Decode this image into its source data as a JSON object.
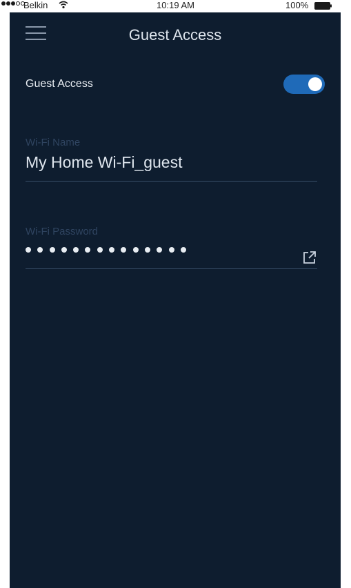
{
  "status_bar": {
    "signal": "●●●○○",
    "carrier": "Belkin",
    "time": "10:19 AM",
    "battery": "100%"
  },
  "header": {
    "menu_icon": "hamburger-icon",
    "title": "Guest Access"
  },
  "guest_access": {
    "label": "Guest Access",
    "enabled": true,
    "toggle_color": "#1f6ab8"
  },
  "wifi_name": {
    "label": "Wi-Fi Name",
    "value": "My Home Wi-Fi_guest"
  },
  "wifi_password": {
    "label": "Wi-Fi Password",
    "masked_value": "••••••••••••••",
    "share_icon": "share-external-icon"
  },
  "colors": {
    "background": "#0e1d2f",
    "accent": "#1f6ab8",
    "text": "#dfe6ee",
    "muted_label": "#2f4460"
  }
}
